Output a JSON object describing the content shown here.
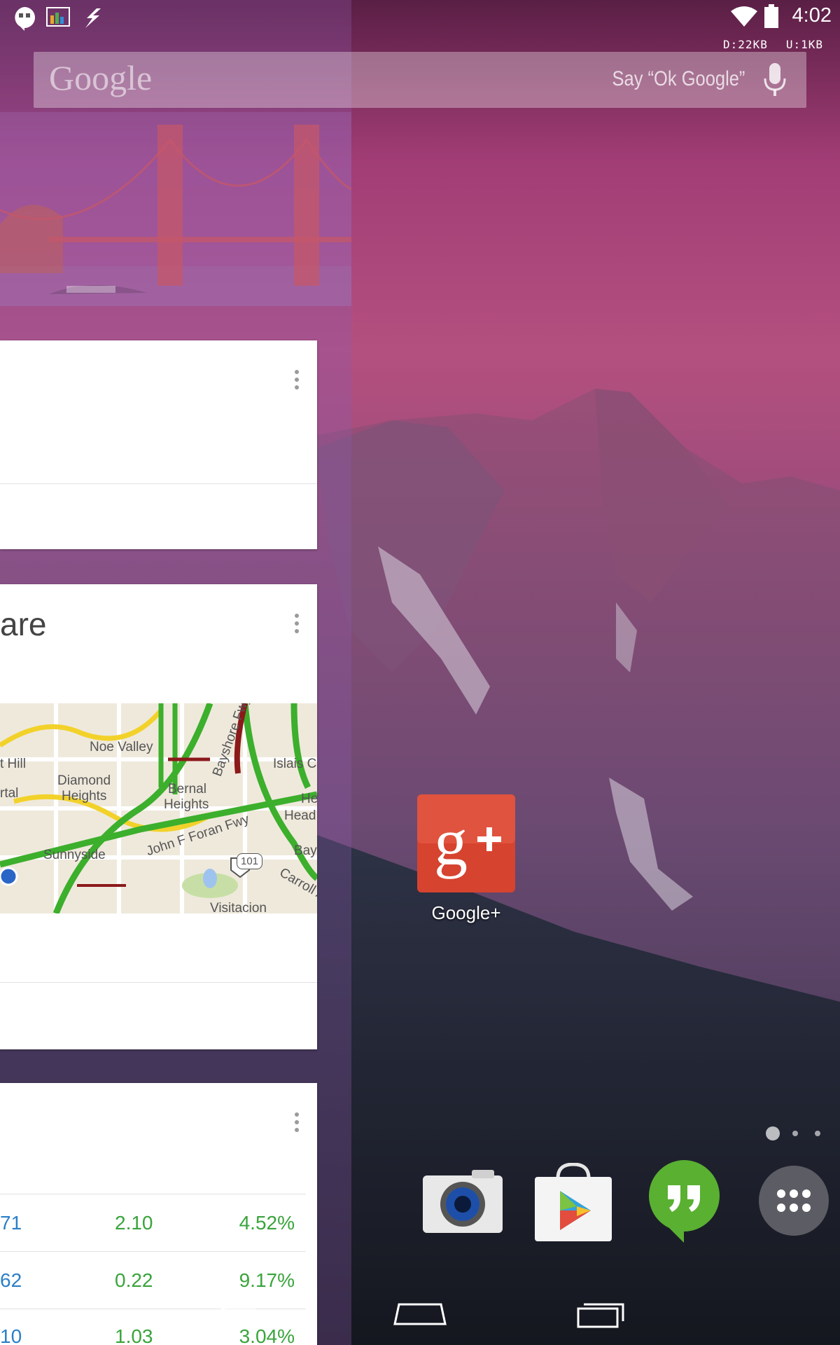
{
  "status_bar": {
    "time": "4:02",
    "icons": [
      "hangouts-icon",
      "taskmanager-icon",
      "flash-icon",
      "wifi-icon",
      "battery-icon"
    ],
    "download": "D:22KB",
    "upload": "U:1KB"
  },
  "search": {
    "logo": "Google",
    "hint": "Say “Ok Google”"
  },
  "now_cards": {
    "card2_title": "are",
    "map": {
      "labels": [
        "Noe Valley",
        "t Hill",
        "Diamond",
        "Heights",
        "rtal",
        "Bernal",
        "Heights",
        "Islais C",
        "Sunnyside",
        "John F Foran Fwy",
        "Bayshore Fwy",
        "101",
        "Carroll A",
        "Visitacion",
        "He",
        "Head",
        "Bay"
      ]
    },
    "stocks": [
      {
        "price": "71",
        "change": "2.10",
        "percent": "4.52%"
      },
      {
        "price": "62",
        "change": "0.22",
        "percent": "9.17%"
      },
      {
        "price": "10",
        "change": "1.03",
        "percent": "3.04%"
      }
    ]
  },
  "home": {
    "google_plus_label": "Google+",
    "dock": [
      "camera-icon",
      "play-store-icon",
      "hangouts-icon",
      "app-drawer-icon"
    ]
  },
  "colors": {
    "accent_red": "#d6432f",
    "hangouts_green": "#5ab031",
    "stock_blue": "#2a7fc9",
    "stock_green": "#3aa43c"
  }
}
